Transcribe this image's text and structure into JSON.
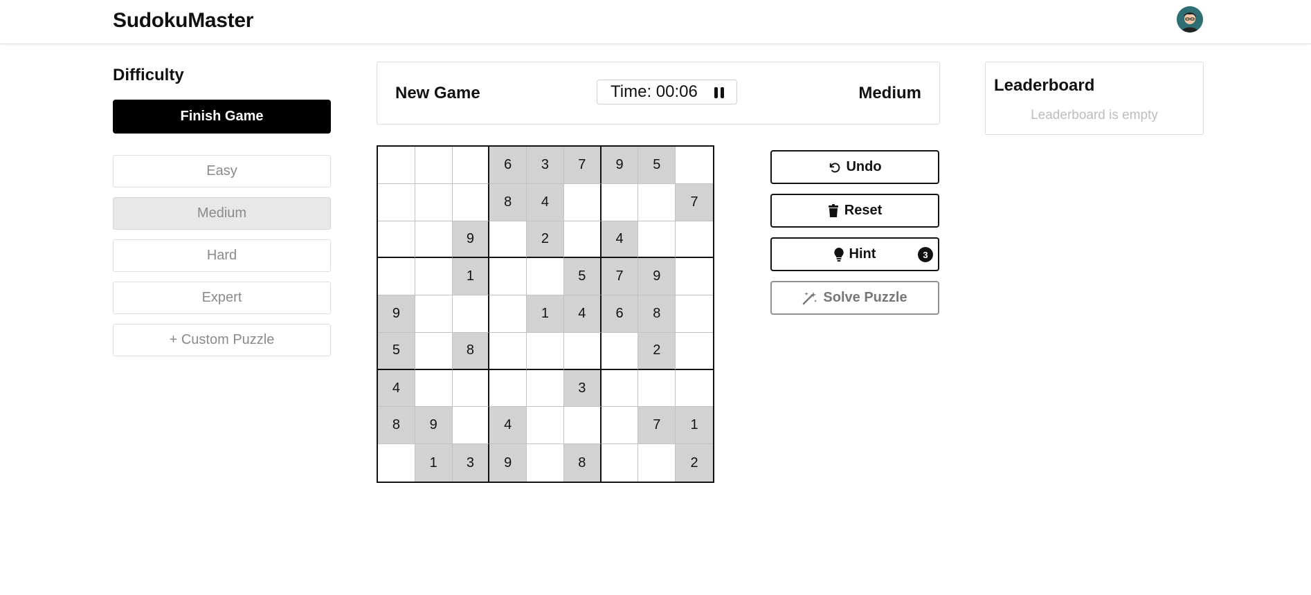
{
  "app": {
    "title": "SudokuMaster"
  },
  "sidebar": {
    "title": "Difficulty",
    "finish_label": "Finish Game",
    "items": [
      {
        "label": "Easy",
        "selected": false
      },
      {
        "label": "Medium",
        "selected": true
      },
      {
        "label": "Hard",
        "selected": false
      },
      {
        "label": "Expert",
        "selected": false
      },
      {
        "label": "+ Custom Puzzle",
        "selected": false
      }
    ]
  },
  "game": {
    "new_game_label": "New Game",
    "timer_label": "Time: 00:06",
    "level": "Medium"
  },
  "board": {
    "rows": [
      [
        "",
        "",
        "",
        "6",
        "3",
        "7",
        "9",
        "5",
        ""
      ],
      [
        "",
        "",
        "",
        "8",
        "4",
        "",
        "",
        "",
        "7"
      ],
      [
        "",
        "",
        "9",
        "",
        "2",
        "",
        "4",
        "",
        ""
      ],
      [
        "",
        "",
        "1",
        "",
        "",
        "5",
        "7",
        "9",
        ""
      ],
      [
        "9",
        "",
        "",
        "",
        "1",
        "4",
        "6",
        "8",
        ""
      ],
      [
        "5",
        "",
        "8",
        "",
        "",
        "",
        "",
        "2",
        ""
      ],
      [
        "4",
        "",
        "",
        "",
        "",
        "3",
        "",
        "",
        ""
      ],
      [
        "8",
        "9",
        "",
        "4",
        "",
        "",
        "",
        "7",
        "1"
      ],
      [
        "",
        "1",
        "3",
        "9",
        "",
        "8",
        "",
        "",
        "2"
      ]
    ]
  },
  "actions": {
    "undo_label": "Undo",
    "reset_label": "Reset",
    "hint_label": "Hint",
    "hint_count": "3",
    "solve_label": "Solve Puzzle"
  },
  "leaderboard": {
    "title": "Leaderboard",
    "empty_text": "Leaderboard is empty"
  },
  "colors": {
    "accent": "#000000",
    "given_cell": "#d2d2d2",
    "selected_difficulty": "#e8e8e8"
  }
}
